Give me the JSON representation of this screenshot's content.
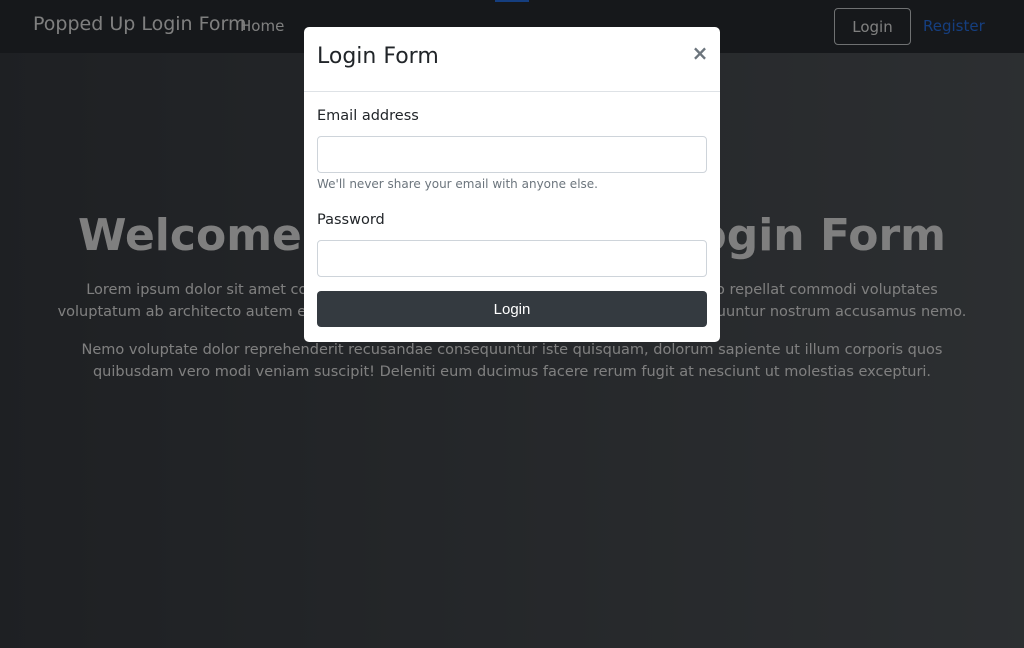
{
  "navbar": {
    "brand": "Popped Up Login Form",
    "home": "Home",
    "login": "Login",
    "register": "Register"
  },
  "hero": {
    "title": "Welcome to Popped Up Login Form",
    "paragraph1": "Lorem ipsum dolor sit amet consectetur adipisicing elit. Voluptatem quasi, voluptas quo repellat commodi voluptates voluptatum ab architecto autem ex laborum, quisquam lorem ipsum dolor sit amet consequuntur nostrum accusamus nemo.",
    "paragraph2": "Nemo voluptate dolor reprehenderit recusandae consequuntur iste quisquam, dolorum sapiente ut illum corporis quos quibusdam vero modi veniam suscipit! Deleniti eum ducimus facere rerum fugit at nesciunt ut molestias excepturi."
  },
  "modal": {
    "title": "Login Form",
    "close": "×",
    "email_label": "Email address",
    "email_value": "",
    "email_help": "We'll never share your email with anyone else.",
    "password_label": "Password",
    "password_value": "",
    "submit": "Login"
  },
  "colors": {
    "navbar": "#2c3136",
    "accent": "#2b7cff",
    "button_dark": "#343a40",
    "modal_bg": "#ffffff"
  },
  "icons": {
    "close": "close-icon"
  }
}
